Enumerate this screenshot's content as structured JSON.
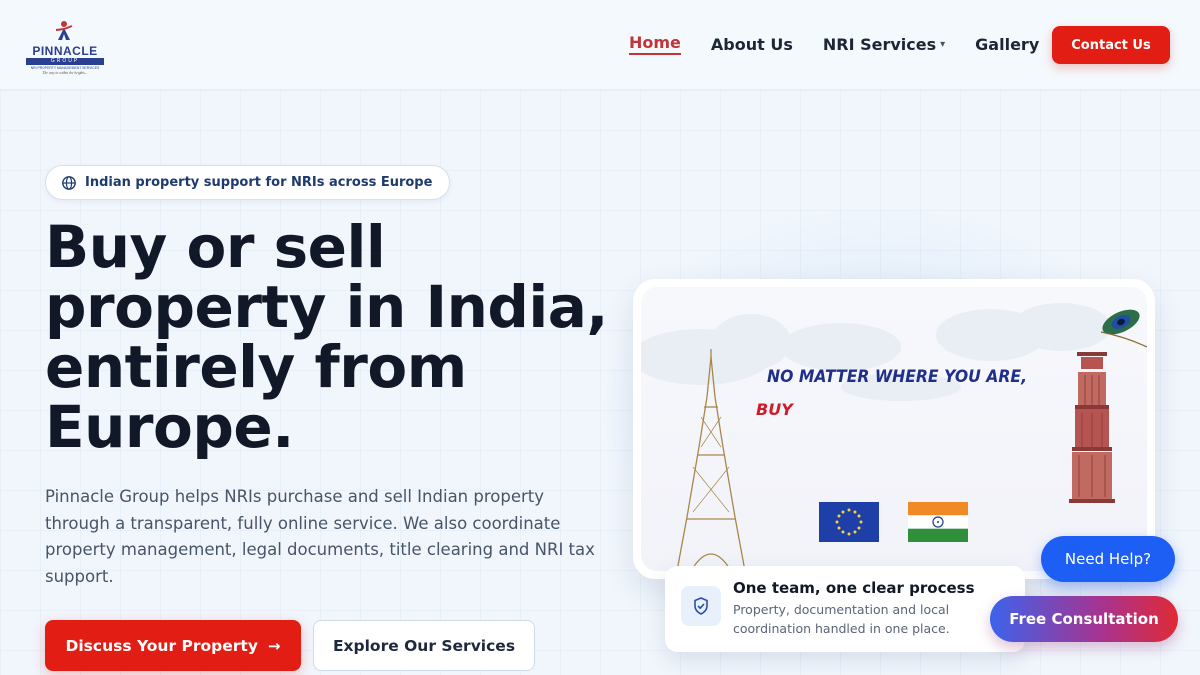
{
  "brand": {
    "name": "PINNACLE",
    "bar": "GROUP",
    "sub": "NRI PROPERTY MANAGEMENT SERVICES",
    "tagline": "The way to within the heights..."
  },
  "nav": {
    "items": [
      {
        "label": "Home",
        "active": true
      },
      {
        "label": "About Us"
      },
      {
        "label": "NRI Services",
        "caret": "▾"
      },
      {
        "label": "Gallery"
      }
    ],
    "contact_label": "Contact Us"
  },
  "hero": {
    "pill": "Indian property support for NRIs across Europe",
    "headline": "Buy or sell property in India, entirely from Europe.",
    "description": "Pinnacle Group helps NRIs purchase and sell Indian property through a transparent, fully online service. We also coordinate property management, legal documents, title clearing and NRI tax support.",
    "primary_cta": "Discuss Your Property",
    "primary_cta_arrow": "→",
    "secondary_cta": "Explore Our Services"
  },
  "media": {
    "line1": "NO MATTER WHERE YOU ARE,",
    "line2": "BUY"
  },
  "info_card": {
    "title": "One team, one clear process",
    "text": "Property, documentation and local coordination handled in one place."
  },
  "floating": {
    "help_label": "Need Help?",
    "consult_label": "Free Consultation"
  },
  "colors": {
    "accent_red": "#e11d14",
    "navy": "#1e3a6e",
    "help_blue": "#1d5ff5"
  }
}
